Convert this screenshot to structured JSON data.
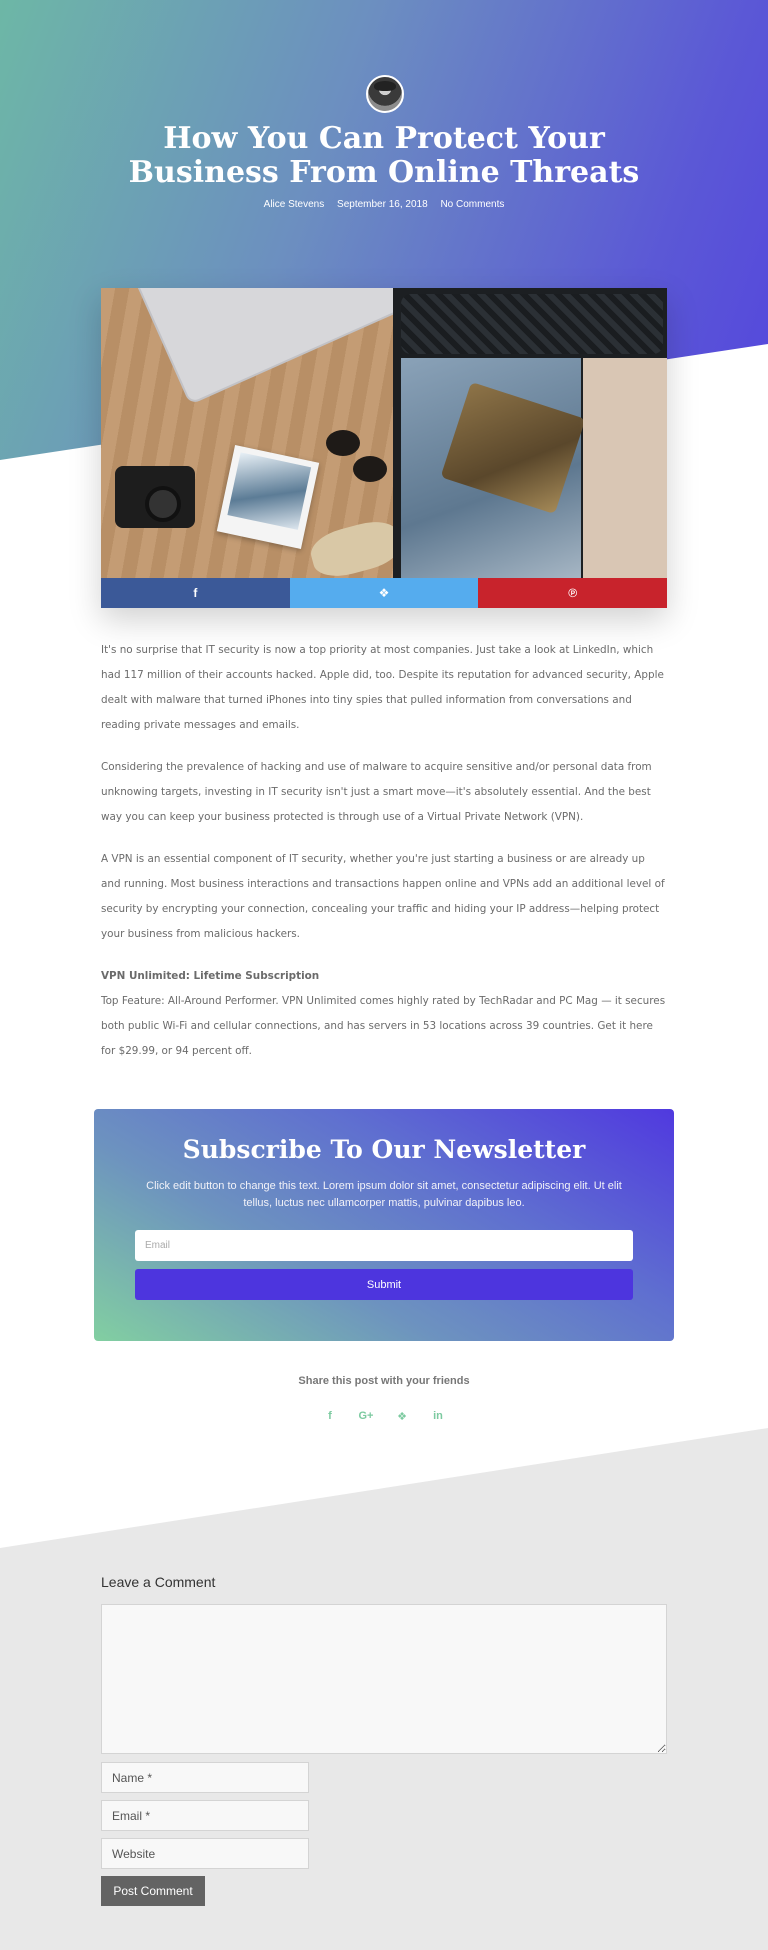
{
  "post": {
    "title": "How You Can Protect Your Business From Online Threats",
    "author": "Alice Stevens",
    "date": "September 16, 2018",
    "comments": "No Comments"
  },
  "share_bar": [
    {
      "icon": "facebook-icon",
      "glyph": "f",
      "color": "#3b5998"
    },
    {
      "icon": "twitter-icon",
      "glyph": "❖",
      "color": "#55acee"
    },
    {
      "icon": "pinterest-icon",
      "glyph": "℗",
      "color": "#c8232c"
    }
  ],
  "content": {
    "p1": "It's no surprise that IT security is now a top priority at most companies. Just take a look at LinkedIn, which had 117 million of their accounts hacked. Apple did, too. Despite its reputation for advanced security, Apple dealt with malware that turned iPhones into tiny spies that pulled information from conversations and reading private messages and emails.",
    "p2": "Considering the prevalence of hacking and use of malware to acquire sensitive and/or personal data from unknowing targets, investing in IT security isn't just a smart move—it's absolutely essential. And the best way you can keep your business protected is through use of a Virtual Private Network (VPN).",
    "p3": "A VPN is an essential component of IT security, whether you're just starting a business or are already up and running. Most business interactions and transactions happen online and VPNs add an additional level of security by encrypting your connection, concealing your traffic and hiding your IP address—helping protect your business from malicious hackers.",
    "p4_heading": "VPN Unlimited: Lifetime Subscription",
    "p4": "Top Feature: All-Around Performer. VPN Unlimited comes highly rated by TechRadar and PC Mag — it secures both public Wi-Fi and cellular connections, and has servers in 53 locations across 39 countries. Get it here for $29.99, or 94 percent off."
  },
  "newsletter": {
    "title": "Subscribe To Our Newsletter",
    "text": "Click edit button to change this text. Lorem ipsum dolor sit amet, consectetur adipiscing elit. Ut elit tellus, luctus nec ullamcorper mattis, pulvinar dapibus leo.",
    "email_placeholder": "Email",
    "submit_label": "Submit"
  },
  "share_section": {
    "title": "Share this post with your friends",
    "icons": [
      {
        "name": "facebook-icon",
        "glyph": "f"
      },
      {
        "name": "google-plus-icon",
        "glyph": "G+"
      },
      {
        "name": "twitter-icon",
        "glyph": "❖"
      },
      {
        "name": "linkedin-icon",
        "glyph": "in"
      }
    ]
  },
  "comment_form": {
    "title": "Leave a Comment",
    "name_placeholder": "Name *",
    "email_placeholder": "Email *",
    "website_placeholder": "Website",
    "submit_label": "Post Comment"
  }
}
